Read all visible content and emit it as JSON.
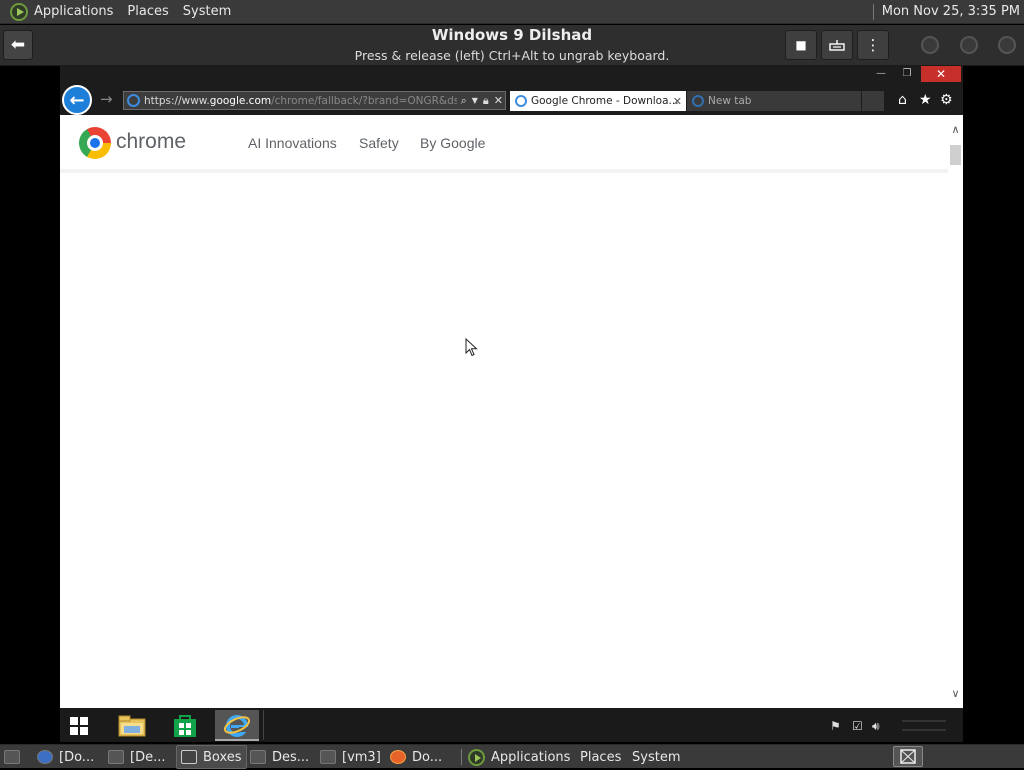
{
  "top_panel": {
    "menus": [
      "Applications",
      "Places",
      "System"
    ],
    "clock": "Mon Nov 25,  3:35 PM"
  },
  "boxes_header": {
    "title": "Windows 9  Dilshad",
    "subtitle": "Press & release (left) Ctrl+Alt to ungrab keyboard."
  },
  "ie": {
    "address_pre": "https://www.",
    "address_host": "google.com",
    "address_rest": "/chrome/fallback/?brand=ONGR&ds_k",
    "tabs": [
      {
        "label": "Google Chrome - Downloa..."
      },
      {
        "label": "New tab"
      }
    ]
  },
  "page": {
    "wordmark": "chrome",
    "nav": [
      "AI Innovations",
      "Safety",
      "By Google"
    ]
  },
  "bottom_panel": {
    "windows": [
      "[Do...",
      "[De...",
      "Boxes",
      "Des...",
      "[vm3]",
      "Do..."
    ],
    "menus": [
      "Applications",
      "Places",
      "System"
    ]
  },
  "colors": {
    "panel": "#3a3a3a",
    "ie_close": "#c7302a",
    "ie_back": "#1e7fd8",
    "page_nav": "#5f6368"
  }
}
